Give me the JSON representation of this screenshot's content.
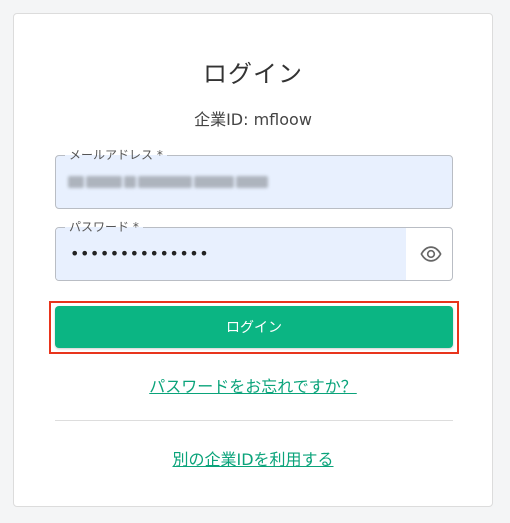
{
  "login_card": {
    "title": "ログイン",
    "company_id": "企業ID: mfloow",
    "email_field": {
      "label": "メールアドレス *",
      "value": "■■■■■■■■■■■■■■■■■■"
    },
    "password_field": {
      "label": "パスワード *",
      "value": "••••••••••••••",
      "toggle_icon": "eye-icon"
    },
    "login_button_label": "ログイン",
    "forgot_password_link": "パスワードをお忘れですか？",
    "other_company_link": "別の企業IDを利用する"
  },
  "colors": {
    "primary": "#0bb583",
    "link": "#0aa37a",
    "highlight": "#e8341c",
    "autofill_bg": "#e8f0fe"
  }
}
